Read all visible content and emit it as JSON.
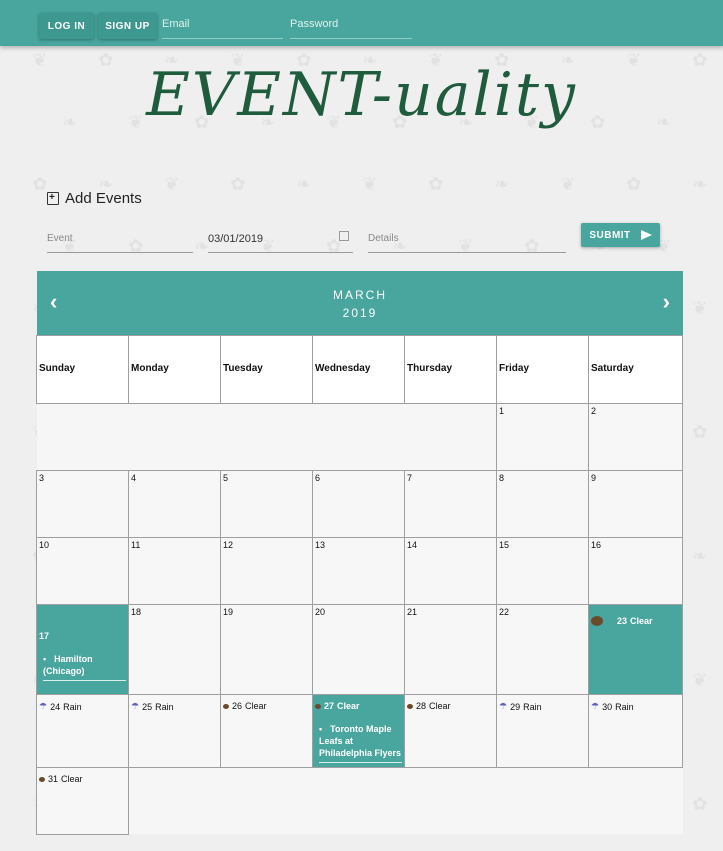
{
  "topbar": {
    "login_label": "LOG IN",
    "signup_label": "SIGN UP",
    "email_placeholder": "Email",
    "password_placeholder": "Password"
  },
  "title": "EVENT-uality",
  "add_events": {
    "heading": "Add Events",
    "event_placeholder": "Event",
    "date_value": "03/01/2019",
    "details_placeholder": "Details",
    "submit_label": "SUBMIT"
  },
  "calendar": {
    "month": "MARCH",
    "year": "2019",
    "prev_glyph": "‹",
    "next_glyph": "›",
    "day_names": [
      "Sunday",
      "Monday",
      "Tuesday",
      "Wednesday",
      "Thursday",
      "Friday",
      "Saturday"
    ],
    "weeks": [
      [
        null,
        null,
        null,
        null,
        null,
        {
          "day": "1"
        },
        {
          "day": "2"
        }
      ],
      [
        {
          "day": "3"
        },
        {
          "day": "4"
        },
        {
          "day": "5"
        },
        {
          "day": "6"
        },
        {
          "day": "7"
        },
        {
          "day": "8"
        },
        {
          "day": "9"
        }
      ],
      [
        {
          "day": "10"
        },
        {
          "day": "11"
        },
        {
          "day": "12"
        },
        {
          "day": "13"
        },
        {
          "day": "14"
        },
        {
          "day": "15"
        },
        {
          "day": "16"
        }
      ],
      [
        {
          "day": "17",
          "highlight": true,
          "events": [
            "Hamilton (Chicago)"
          ]
        },
        {
          "day": "18"
        },
        {
          "day": "19"
        },
        {
          "day": "20"
        },
        {
          "day": "21"
        },
        {
          "day": "22"
        },
        {
          "day": "23",
          "highlight": true,
          "weather": "Clear",
          "weather_icon": "sun-icon"
        }
      ],
      [
        {
          "day": "24",
          "weather": "Rain",
          "weather_icon": "rain-icon"
        },
        {
          "day": "25",
          "weather": "Rain",
          "weather_icon": "rain-icon"
        },
        {
          "day": "26",
          "weather": "Clear",
          "weather_icon": "sun-icon"
        },
        {
          "day": "27",
          "weather": "Clear",
          "weather_icon": "sun-icon",
          "highlight": true,
          "events": [
            "Toronto Maple Leafs at Philadelphia Flyers"
          ]
        },
        {
          "day": "28",
          "weather": "Clear",
          "weather_icon": "sun-icon"
        },
        {
          "day": "29",
          "weather": "Rain",
          "weather_icon": "rain-icon"
        },
        {
          "day": "30",
          "weather": "Rain",
          "weather_icon": "rain-icon"
        }
      ],
      [
        {
          "day": "31",
          "weather": "Clear",
          "weather_icon": "sun-icon"
        }
      ]
    ]
  },
  "colors": {
    "accent": "#48a69e",
    "title": "#1e5c3d"
  }
}
